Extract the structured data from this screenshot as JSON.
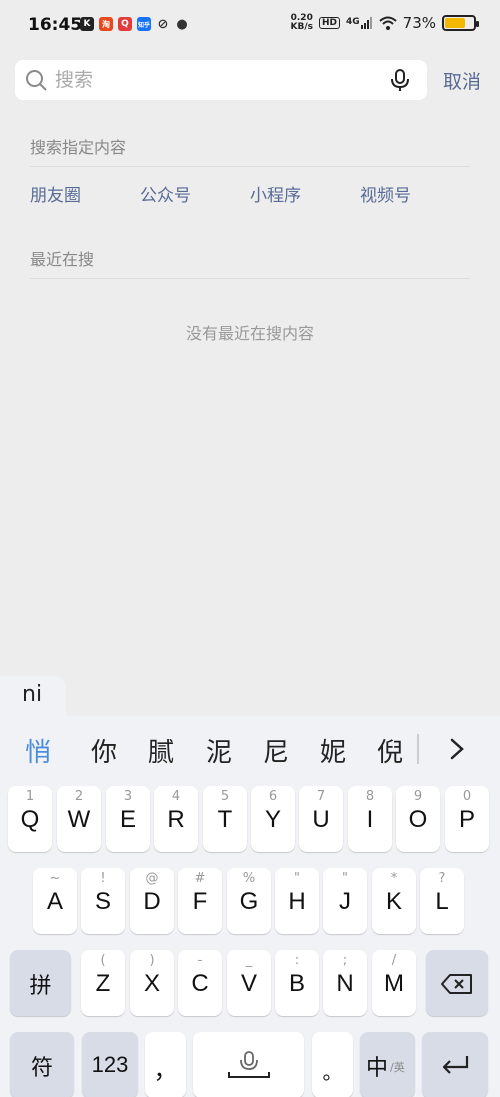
{
  "status_bar": {
    "time": "16:45",
    "app_icons": [
      {
        "name": "k-app-icon",
        "glyph": "K",
        "color": "#222222"
      },
      {
        "name": "taobao-icon",
        "glyph": "淘",
        "color": "#e8481b"
      },
      {
        "name": "q-app-icon",
        "glyph": "Q",
        "color": "#e23b3b"
      },
      {
        "name": "zhihu-icon",
        "glyph": "知乎",
        "color": "#1772f6"
      },
      {
        "name": "link-app-icon",
        "glyph": "⊘",
        "color": "#333333"
      },
      {
        "name": "message-icon",
        "glyph": "●",
        "color": "#333333"
      }
    ],
    "net_speed_value": "0.20",
    "net_speed_unit": "KB/s",
    "hd_label": "HD",
    "signal_label": "4G",
    "battery_percent": "73%",
    "battery_level": 0.73
  },
  "search": {
    "placeholder": "搜索",
    "value": "",
    "cancel_label": "取消"
  },
  "specified_content": {
    "title": "搜索指定内容",
    "items": [
      "朋友圈",
      "公众号",
      "小程序",
      "视频号"
    ]
  },
  "recent": {
    "title": "最近在搜",
    "empty_text": "没有最近在搜内容"
  },
  "ime": {
    "pinyin": "ni",
    "candidates": [
      "悄",
      "你",
      "腻",
      "泥",
      "尼",
      "妮",
      "倪"
    ],
    "row1": [
      {
        "main": "Q",
        "sub": "1"
      },
      {
        "main": "W",
        "sub": "2"
      },
      {
        "main": "E",
        "sub": "3"
      },
      {
        "main": "R",
        "sub": "4"
      },
      {
        "main": "T",
        "sub": "5"
      },
      {
        "main": "Y",
        "sub": "6"
      },
      {
        "main": "U",
        "sub": "7"
      },
      {
        "main": "I",
        "sub": "8"
      },
      {
        "main": "O",
        "sub": "9"
      },
      {
        "main": "P",
        "sub": "0"
      }
    ],
    "row2": [
      {
        "main": "A",
        "sub": "~"
      },
      {
        "main": "S",
        "sub": "!"
      },
      {
        "main": "D",
        "sub": "@"
      },
      {
        "main": "F",
        "sub": "#"
      },
      {
        "main": "G",
        "sub": "%"
      },
      {
        "main": "H",
        "sub": "\""
      },
      {
        "main": "J",
        "sub": "\""
      },
      {
        "main": "K",
        "sub": "*"
      },
      {
        "main": "L",
        "sub": "?"
      }
    ],
    "row3": [
      {
        "main": "Z",
        "sub": "("
      },
      {
        "main": "X",
        "sub": ")"
      },
      {
        "main": "C",
        "sub": "-"
      },
      {
        "main": "V",
        "sub": "_"
      },
      {
        "main": "B",
        "sub": ":"
      },
      {
        "main": "N",
        "sub": ";"
      },
      {
        "main": "M",
        "sub": "/"
      }
    ],
    "pinyin_key": "拼",
    "symbol_key": "符",
    "number_key": "123",
    "comma_key": "，",
    "period_key": "。",
    "lang_key_main": "中",
    "lang_key_sub": "/英"
  }
}
